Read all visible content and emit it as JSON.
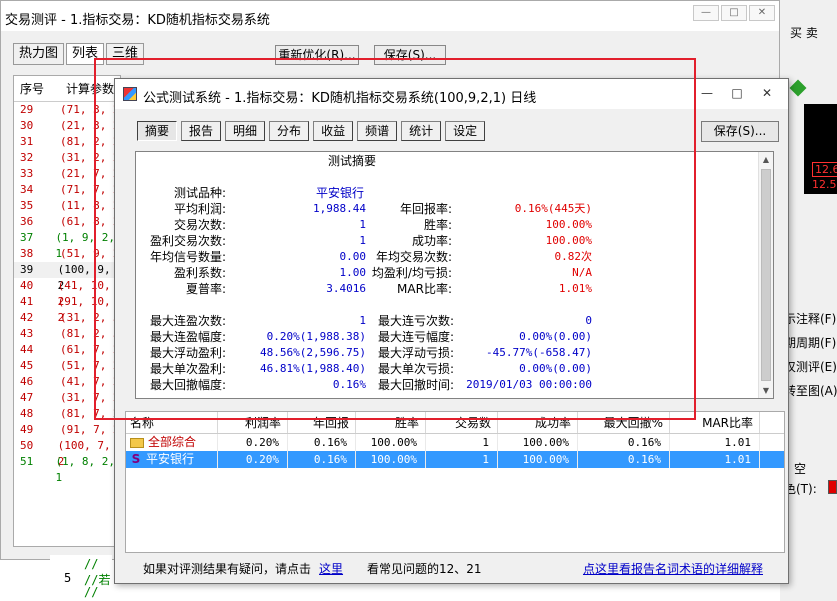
{
  "back_window": {
    "title": "交易测评 - 1.指标交易：KD随机指标交易系统",
    "controls": [
      "—",
      "□",
      "✕"
    ],
    "tabs": [
      "热力图",
      "列表",
      "三维"
    ],
    "reoptimize_label": "重新优化(R)...",
    "save_label": "保存(S)...",
    "list_header": [
      "序号",
      "计算参数"
    ],
    "rows": [
      {
        "n": "29",
        "p": "(71, 3, 2",
        "c": "red"
      },
      {
        "n": "30",
        "p": "(21, 3, 2",
        "c": "red"
      },
      {
        "n": "31",
        "p": "(81, 2, 2",
        "c": "red"
      },
      {
        "n": "32",
        "p": "(31, 2, 2",
        "c": "red"
      },
      {
        "n": "33",
        "p": "(21, 7, 2",
        "c": "red"
      },
      {
        "n": "34",
        "p": "(71, 7, 2",
        "c": "red"
      },
      {
        "n": "35",
        "p": "(11, 8, 2",
        "c": "red"
      },
      {
        "n": "36",
        "p": "(61, 8, 2",
        "c": "red"
      },
      {
        "n": "37",
        "p": "(1, 9, 2, 1",
        "c": "green"
      },
      {
        "n": "38",
        "p": "(51, 9, 2",
        "c": "red"
      },
      {
        "n": "39",
        "p": "(100, 9, 2",
        "c": "sel"
      },
      {
        "n": "40",
        "p": "(41, 10, 2",
        "c": "red"
      },
      {
        "n": "41",
        "p": "(91, 10, 2",
        "c": "red"
      },
      {
        "n": "42",
        "p": "(31, 2, 5",
        "c": "red"
      },
      {
        "n": "43",
        "p": "(81, 2, 5",
        "c": "red"
      },
      {
        "n": "44",
        "p": "(61, 7, 2",
        "c": "red"
      },
      {
        "n": "45",
        "p": "(51, 7, 2",
        "c": "red"
      },
      {
        "n": "46",
        "p": "(41, 7, 2",
        "c": "red"
      },
      {
        "n": "47",
        "p": "(31, 7, 2",
        "c": "red"
      },
      {
        "n": "48",
        "p": "(81, 7, 2",
        "c": "red"
      },
      {
        "n": "49",
        "p": "(91, 7, 2",
        "c": "red"
      },
      {
        "n": "50",
        "p": "(100, 7, 2",
        "c": "red"
      },
      {
        "n": "51",
        "p": "(1, 8, 2, 1",
        "c": "green"
      }
    ]
  },
  "right_strip": {
    "menu": "买  卖",
    "price1": "12.6",
    "price2": "12.5",
    "items": [
      "示注释(F)",
      "期周期(F)",
      "叹测评(E)",
      "转至图(A)"
    ],
    "tab_label": "空",
    "color_label": "色(T):"
  },
  "code_strip": {
    "line1": "//",
    "line_no": "5",
    "line2": "//若",
    "line3": "//"
  },
  "dialog": {
    "title": "公式测试系统 - 1.指标交易：KD随机指标交易系统(100,9,2,1) 日线",
    "controls": [
      "—",
      "□",
      "✕"
    ],
    "tabs": [
      "摘要",
      "报告",
      "明细",
      "分布",
      "收益",
      "频谱",
      "统计",
      "设定"
    ],
    "save_label": "保存(S)...",
    "summary": {
      "heading": "测试摘要",
      "fields": {
        "instrument_label": "测试品种:",
        "instrument": "平安银行",
        "avg_profit_label": "平均利润:",
        "avg_profit": "1,988.44",
        "annual_return_label": "年回报率:",
        "annual_return": "0.16%(445天)",
        "trade_count_label": "交易次数:",
        "trade_count": "1",
        "win_rate_label": "胜率:",
        "win_rate": "100.00%",
        "profit_trades_label": "盈利交易次数:",
        "profit_trades": "1",
        "success_rate_label": "成功率:",
        "success_rate": "100.00%",
        "annual_signals_label": "年均信号数量:",
        "annual_signals": "0.00",
        "annual_trades_label": "年均交易次数:",
        "annual_trades": "0.82次",
        "profit_factor_label": "盈利系数:",
        "profit_factor": "1.00",
        "avg_win_loss_label": "均盈利/均亏损:",
        "avg_win_loss": "N/A",
        "sharpe_label": "夏普率:",
        "sharpe": "3.4016",
        "mar_label": "MAR比率:",
        "mar": "1.01%",
        "max_win_streak_label": "最大连盈次数:",
        "max_win_streak": "1",
        "max_loss_streak_label": "最大连亏次数:",
        "max_loss_streak": "0",
        "max_win_streak_amt_label": "最大连盈幅度:",
        "max_win_streak_amt": "0.20%(1,988.38)",
        "max_loss_streak_amt_label": "最大连亏幅度:",
        "max_loss_streak_amt": "0.00%(0.00)",
        "max_float_profit_label": "最大浮动盈利:",
        "max_float_profit": "48.56%(2,596.75)",
        "max_float_loss_label": "最大浮动亏损:",
        "max_float_loss": "-45.77%(-658.47)",
        "max_single_profit_label": "最大单次盈利:",
        "max_single_profit": "46.81%(1,988.40)",
        "max_single_loss_label": "最大单次亏损:",
        "max_single_loss": "0.00%(0.00)",
        "max_drawdown_label": "最大回撤幅度:",
        "max_drawdown": "0.16%",
        "max_drawdown_time_label": "最大回撤时间:",
        "max_drawdown_time": "2019/01/03 00:00:00"
      }
    },
    "table": {
      "headers": [
        "名称",
        "利润率",
        "年回报",
        "胜率",
        "交易数",
        "成功率",
        "最大回撤%",
        "MAR比率"
      ],
      "rows": [
        {
          "icon": "folder-icon",
          "name": "全部综合",
          "profit": "0.20%",
          "annual": "0.16%",
          "win": "100.00%",
          "trades": "1",
          "success": "100.00%",
          "drawdown": "0.16%",
          "mar": "1.01"
        },
        {
          "icon": "stock-s-icon",
          "name": "平安银行",
          "profit": "0.20%",
          "annual": "0.16%",
          "win": "100.00%",
          "trades": "1",
          "success": "100.00%",
          "drawdown": "0.16%",
          "mar": "1.01"
        }
      ]
    },
    "footer": {
      "question": "如果对评测结果有疑问，请点击",
      "here_link": "这里",
      "faq": "看常见问题的12、21",
      "glossary_link": "点这里看报告名词术语的详细解释"
    }
  }
}
